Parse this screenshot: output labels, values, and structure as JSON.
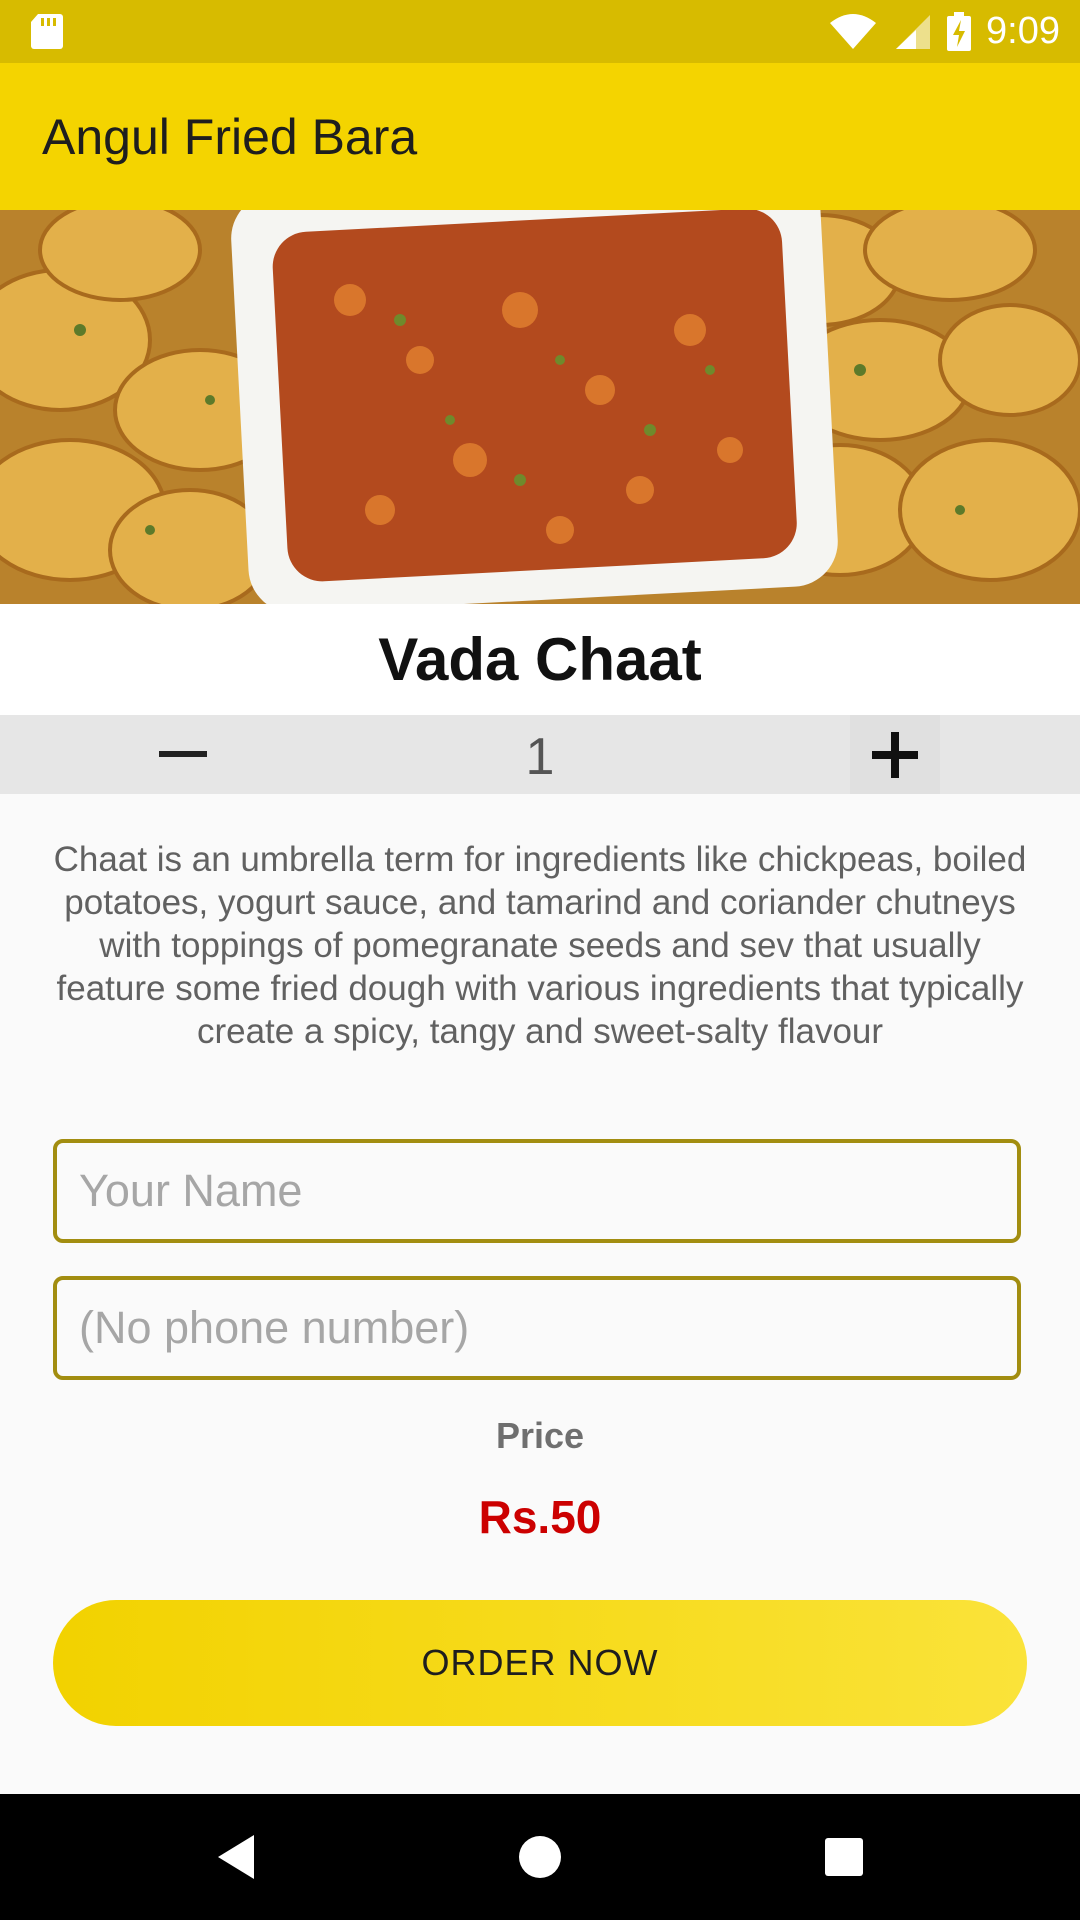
{
  "status_bar": {
    "time": "9:09",
    "icons": [
      "sd-card-icon",
      "wifi-icon",
      "signal-icon",
      "battery-charging-icon"
    ]
  },
  "app_bar": {
    "title": "Angul Fried Bara"
  },
  "item": {
    "name": "Vada Chaat",
    "image": "vada-chaat-photo",
    "quantity": "1",
    "description": "Chaat is an umbrella term for ingredients like chickpeas, boiled potatoes, yogurt sauce, and tamarind and coriander chutneys with toppings of pomegranate seeds and sev  that usually feature some fried dough with various ingredients that typically create a spicy, tangy and sweet-salty flavour"
  },
  "form": {
    "name_placeholder": "Your Name",
    "name_value": "",
    "phone_placeholder": "(No phone number)",
    "phone_value": ""
  },
  "price": {
    "label": "Price",
    "value": "Rs.50"
  },
  "order_button": {
    "label": "ORDER NOW"
  },
  "colors": {
    "status_bar": "#d7bb00",
    "app_bar": "#f4d400",
    "field_border": "#a28d10",
    "price": "#cc0000",
    "button": "#f4d400"
  },
  "nav_bar": {
    "icons": [
      "back-icon",
      "home-icon",
      "recents-icon"
    ]
  }
}
